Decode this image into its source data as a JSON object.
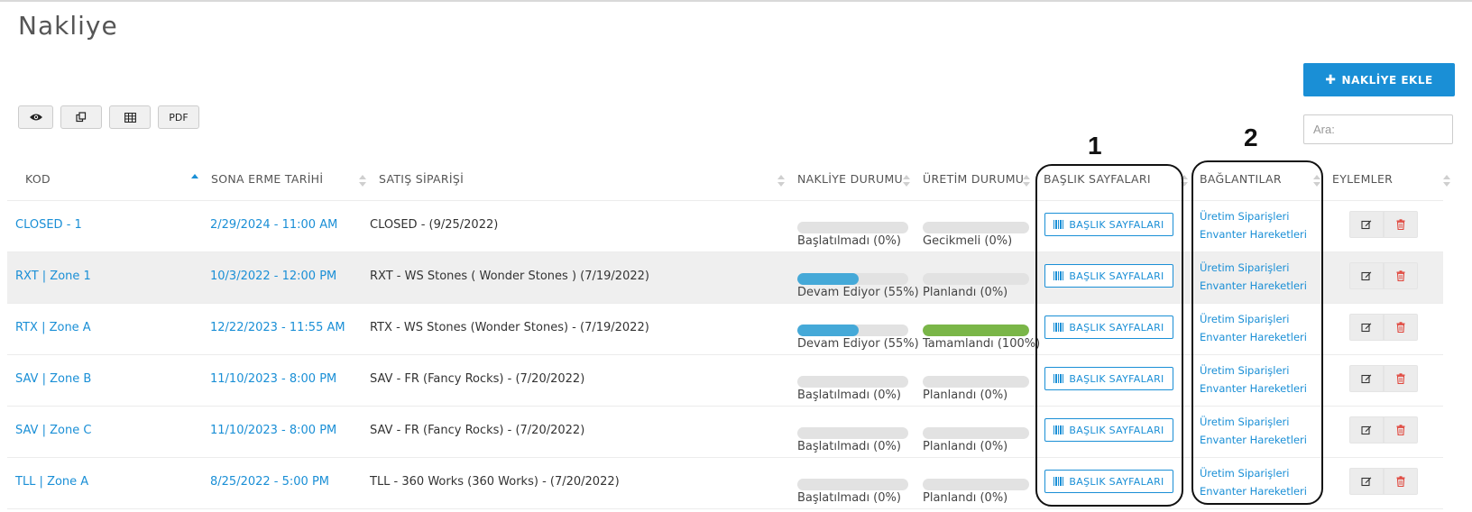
{
  "page": {
    "title": "Nakliye"
  },
  "toolbar": {
    "add_label": "NAKLİYE EKLE",
    "pdf_label": "PDF"
  },
  "search": {
    "placeholder": "Ara:"
  },
  "table": {
    "headers": {
      "kod": "KOD",
      "sona_erme": "SONA ERME TARİHİ",
      "satis": "SATIŞ SİPARİŞİ",
      "nakliye_durumu": "NAKLİYE DURUMU",
      "uretim_durumu": "ÜRETİM DURUMU",
      "baslik": "BAŞLIK SAYFALARI",
      "baglantilar": "BAĞLANTILAR",
      "eylemler": "EYLEMLER"
    },
    "rows": [
      {
        "kod": "CLOSED - 1",
        "sona_erme": "2/29/2024 - 11:00 AM",
        "satis": "CLOSED - (9/25/2022)",
        "nakliye_label": "Başlatılmadı (0%)",
        "nakliye_pct": 0,
        "uretim_label": "Gecikmeli (0%)",
        "uretim_pct": 0,
        "baslik_label": "BAŞLIK SAYFALARI",
        "link1": "Üretim Siparişleri",
        "link2": "Envanter Hareketleri"
      },
      {
        "kod": "RXT | Zone 1",
        "sona_erme": "10/3/2022 - 12:00 PM",
        "satis": "RXT - WS Stones ( Wonder Stones ) (7/19/2022)",
        "nakliye_label": "Devam Ediyor (55%)",
        "nakliye_pct": 55,
        "uretim_label": "Planlandı (0%)",
        "uretim_pct": 0,
        "baslik_label": "BAŞLIK SAYFALARI",
        "link1": "Üretim Siparişleri",
        "link2": "Envanter Hareketleri"
      },
      {
        "kod": "RTX | Zone A",
        "sona_erme": "12/22/2023 - 11:55 AM",
        "satis": "RTX - WS Stones (Wonder Stones) - (7/19/2022)",
        "nakliye_label": "Devam Ediyor (55%)",
        "nakliye_pct": 55,
        "uretim_label": "Tamamlandı (100%)",
        "uretim_pct": 100,
        "baslik_label": "BAŞLIK SAYFALARI",
        "link1": "Üretim Siparişleri",
        "link2": "Envanter Hareketleri"
      },
      {
        "kod": "SAV | Zone B",
        "sona_erme": "11/10/2023 - 8:00 PM",
        "satis": "SAV - FR (Fancy Rocks) - (7/20/2022)",
        "nakliye_label": "Başlatılmadı (0%)",
        "nakliye_pct": 0,
        "uretim_label": "Planlandı (0%)",
        "uretim_pct": 0,
        "baslik_label": "BAŞLIK SAYFALARI",
        "link1": "Üretim Siparişleri",
        "link2": "Envanter Hareketleri"
      },
      {
        "kod": "SAV | Zone C",
        "sona_erme": "11/10/2023 - 8:00 PM",
        "satis": "SAV - FR (Fancy Rocks) - (7/20/2022)",
        "nakliye_label": "Başlatılmadı (0%)",
        "nakliye_pct": 0,
        "uretim_label": "Planlandı (0%)",
        "uretim_pct": 0,
        "baslik_label": "BAŞLIK SAYFALARI",
        "link1": "Üretim Siparişleri",
        "link2": "Envanter Hareketleri"
      },
      {
        "kod": "TLL | Zone A",
        "sona_erme": "8/25/2022 - 5:00 PM",
        "satis": "TLL - 360 Works (360 Works) - (7/20/2022)",
        "nakliye_label": "Başlatılmadı (0%)",
        "nakliye_pct": 0,
        "uretim_label": "Planlandı (0%)",
        "uretim_pct": 0,
        "baslik_label": "BAŞLIK SAYFALARI",
        "link1": "Üretim Siparişleri",
        "link2": "Envanter Hareketleri"
      }
    ]
  },
  "annotations": {
    "label_1": "1",
    "label_2": "2"
  },
  "colors": {
    "accent": "#1a8fd6",
    "progress_blue": "#45a9d8",
    "progress_green": "#7ab648",
    "delete_red": "#e0463c"
  },
  "icons": [
    "eye-icon",
    "copy-icon",
    "table-icon",
    "barcode-icon",
    "edit-icon",
    "trash-icon",
    "plus-icon"
  ]
}
